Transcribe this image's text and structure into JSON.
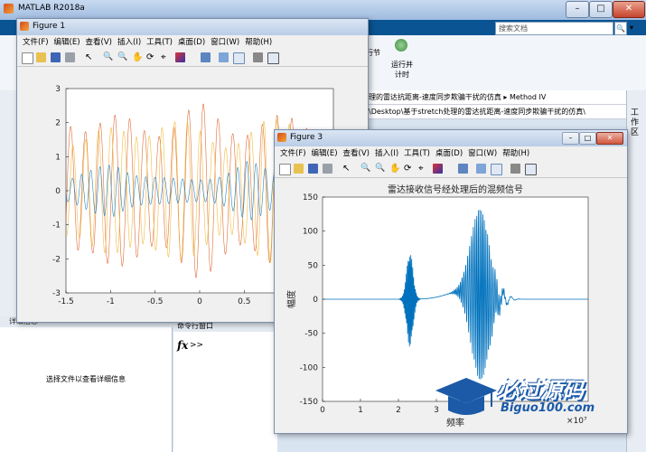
{
  "matlab": {
    "title": "MATLAB R2018a",
    "search_placeholder": "搜索文档",
    "ribbon_items": [
      "行节",
      "运行并",
      "计时"
    ],
    "address_path": "理的雷达抗距离-速度同步欺骗干扰的仿真 ▸ Method IV",
    "address_full": "\\Desktop\\基于stretch处理的雷达抗距离-速度同步欺骗干扰的仿真\\",
    "right_panel_label": "工作区",
    "detail_header": "详细信息",
    "detail_message": "选择文件以查看详细信息",
    "cmd_header": "命令行窗口",
    "cmd_prompt": ">>",
    "fx_label": "fx"
  },
  "figure1": {
    "title": "Figure 1",
    "menu": [
      "文件(F)",
      "编辑(E)",
      "查看(V)",
      "插入(I)",
      "工具(T)",
      "桌面(D)",
      "窗口(W)",
      "帮助(H)"
    ],
    "chart_data": {
      "type": "line",
      "xlim": [
        -1.5,
        1.5
      ],
      "ylim": [
        -3,
        3
      ],
      "x_ticks": [
        "-1.5",
        "-1",
        "-0.5",
        "0",
        "0.5"
      ],
      "y_ticks": [
        "3",
        "2",
        "1",
        "0",
        "-1",
        "-2",
        "-3"
      ],
      "series_colors": [
        "#d95319",
        "#edb120",
        "#0072bd"
      ]
    }
  },
  "figure3": {
    "title": "Figure 3",
    "menu": [
      "文件(F)",
      "编辑(E)",
      "查看(V)",
      "插入(I)",
      "工具(T)",
      "桌面(D)",
      "窗口(W)",
      "帮助(H)"
    ],
    "chart_data": {
      "type": "line",
      "title": "雷达接收信号经处理后的混频信号",
      "xlabel": "频率",
      "ylabel": "幅度",
      "x_scale_label": "×10⁷",
      "xlim": [
        0,
        7
      ],
      "ylim": [
        -150,
        150
      ],
      "x_ticks": [
        "0",
        "1",
        "2",
        "3",
        "4"
      ],
      "y_ticks": [
        "150",
        "100",
        "50",
        "0",
        "-50",
        "-100",
        "-150"
      ],
      "color": "#0072bd"
    }
  },
  "watermark": {
    "text": "必过源码",
    "url": "Biguo100.com"
  }
}
